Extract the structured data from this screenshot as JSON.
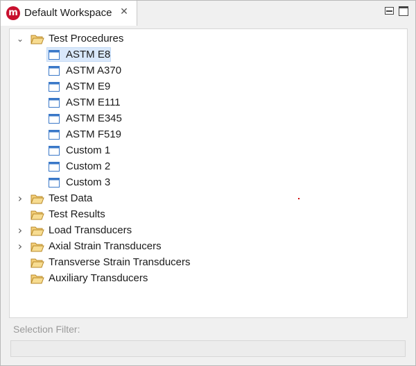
{
  "tab": {
    "icon_letter": "m",
    "title": "Default Workspace",
    "close_glyph": "✕"
  },
  "tree": {
    "expanded_glyph": "⌄",
    "collapsed_glyph": "›",
    "nodes": [
      {
        "label": "Test Procedures",
        "type": "folder",
        "expandable": true,
        "expanded": true,
        "children": [
          {
            "label": "ASTM E8",
            "type": "procedure",
            "selected": true
          },
          {
            "label": "ASTM A370",
            "type": "procedure"
          },
          {
            "label": "ASTM E9",
            "type": "procedure"
          },
          {
            "label": "ASTM E111",
            "type": "procedure"
          },
          {
            "label": "ASTM E345",
            "type": "procedure"
          },
          {
            "label": "ASTM F519",
            "type": "procedure"
          },
          {
            "label": "Custom 1",
            "type": "procedure"
          },
          {
            "label": "Custom 2",
            "type": "procedure"
          },
          {
            "label": "Custom 3",
            "type": "procedure"
          }
        ]
      },
      {
        "label": "Test Data",
        "type": "folder",
        "expandable": true,
        "expanded": false
      },
      {
        "label": "Test Results",
        "type": "folder",
        "expandable": false
      },
      {
        "label": "Load Transducers",
        "type": "folder",
        "expandable": true,
        "expanded": false
      },
      {
        "label": "Axial Strain Transducers",
        "type": "folder",
        "expandable": true,
        "expanded": false
      },
      {
        "label": "Transverse Strain Transducers",
        "type": "folder",
        "expandable": false
      },
      {
        "label": "Auxiliary Transducers",
        "type": "folder",
        "expandable": false
      }
    ]
  },
  "filter": {
    "label": "Selection Filter:",
    "value": ""
  },
  "colors": {
    "selection_bg": "#d9e8fb",
    "folder_fill": "#f3cf7a",
    "folder_edge": "#b88a2a",
    "doc_accent": "#3a78c8",
    "brand_red": "#c8102e"
  }
}
